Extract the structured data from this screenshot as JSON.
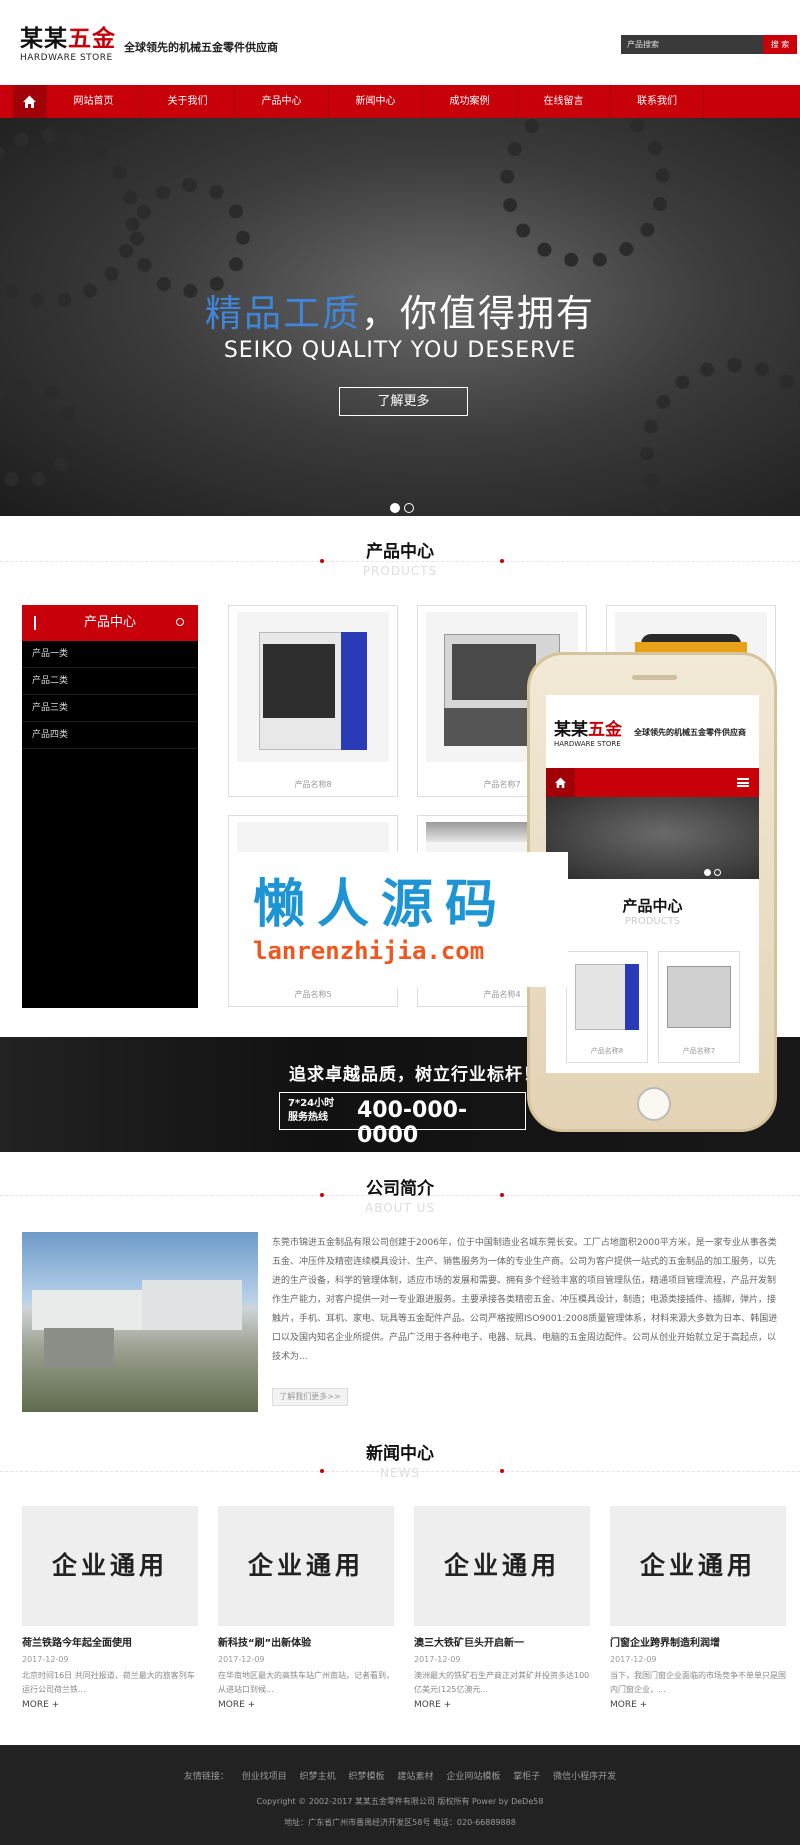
{
  "header": {
    "logo_cn_a": "某某",
    "logo_cn_b": "五金",
    "logo_en": "HARDWARE STORE",
    "slogan": "全球领先的机械五金零件供应商",
    "search_placeholder": "产品搜索",
    "search_button": "搜 索"
  },
  "nav": {
    "items": [
      "网站首页",
      "关于我们",
      "产品中心",
      "新闻中心",
      "成功案例",
      "在线留言",
      "联系我们"
    ]
  },
  "banner": {
    "title_blue": "精品工质",
    "title_white": "，你值得拥有",
    "subtitle": "SEIKO QUALITY YOU DESERVE",
    "more": "了解更多"
  },
  "products": {
    "title_cn": "产品中心",
    "title_en": "PRODUCTS",
    "side_title": "产品中心",
    "categories": [
      "产品一类",
      "产品二类",
      "产品三类",
      "产品四类"
    ],
    "cards": [
      "产品名称8",
      "产品名称7",
      "产品名称5",
      "产品名称4"
    ]
  },
  "hotline": {
    "slogan": "追求卓越品质，树立行业标杆！",
    "label_1": "7*24小时",
    "label_2": "服务热线",
    "number": "400-000-0000"
  },
  "phone_preview": {
    "logo_cn_a": "某某",
    "logo_cn_b": "五金",
    "logo_en": "HARDWARE STORE",
    "slogan": "全球领先的机械五金零件供应商",
    "title_cn": "产品中心",
    "title_en": "PRODUCTS",
    "cards": [
      "产品名称8",
      "产品名称7"
    ]
  },
  "watermark": {
    "cn": "懒人源码",
    "url": "lanrenzhijia.com"
  },
  "about": {
    "title_cn": "公司简介",
    "title_en": "ABOUT US",
    "text": "东莞市锦进五金制品有限公司创建于2006年，位于中国制造业名城东莞长安。工厂占地面积2000平方米，是一家专业从事各类五金、冲压件及精密连续模具设计、生产、销售服务为一体的专业生产商。公司为客户提供一站式的五金制品的加工服务，以先进的生产设备，科学的管理体制，适应市场的发展和需要。拥有多个经验丰富的项目管理队伍，精通项目管理流程，产品开发制作生产能力，对客户提供一对一专业跟进服务。主要承接各类精密五金、冲压模具设计，制造；电源类接插件、插脚，弹片，接触片，手机、耳机、家电、玩具等五金配件产品。公司严格按照ISO9001:2008质量管理体系，材料来源大多数为日本、韩国进口以及国内知名企业所提供。产品广泛用于各种电子、电器、玩具、电脑的五金周边配件。公司从创业开始就立足于高起点，以技术为...",
    "more": "了解我们更多>>"
  },
  "news": {
    "title_cn": "新闻中心",
    "title_en": "NEWS",
    "image_text": "企业通用",
    "more": "MORE +",
    "items": [
      {
        "title": "荷兰铁路今年起全面使用",
        "date": "2017-12-09",
        "desc": "北京时间16日 共同社报道，荷兰最大的旅客列车运行公司荷兰铁..."
      },
      {
        "title": "新科技“刷”出新体验",
        "date": "2017-12-09",
        "desc": "在华南地区最大的高铁车站广州南站，记者看到，从进站口到候..."
      },
      {
        "title": "澳三大铁矿巨头开启新一",
        "date": "2017-12-09",
        "desc": "澳洲最大的铁矿石生产商正对其矿井投资多达100亿美元(125亿澳元..."
      },
      {
        "title": "门窗企业跨界制造利润增",
        "date": "2017-12-09",
        "desc": "当下，我国门窗企业面临的市场竞争不单单只是国内门窗企业，..."
      }
    ]
  },
  "footer": {
    "links_label": "友情链接：",
    "links": [
      "创业找项目",
      "织梦主机",
      "织梦模板",
      "建站素材",
      "企业网站模板",
      "掌柜子",
      "微信小程序开发"
    ],
    "copyright": "Copyright © 2002-2017 某某五金零件有限公司 版权所有 Power by DeDe58",
    "address": "地址：广东省广州市番禺经济开发区58号  电话：020-66889888"
  }
}
